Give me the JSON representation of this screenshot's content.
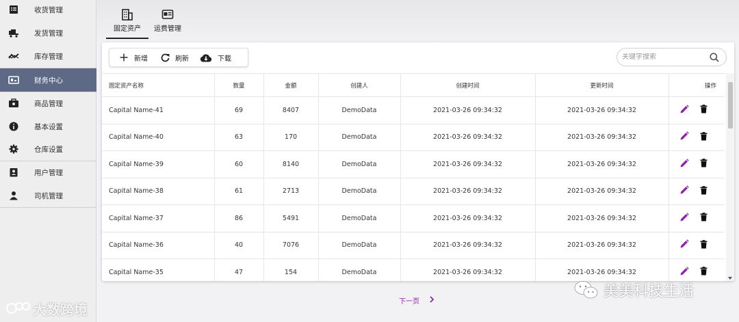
{
  "sidebar": {
    "items": [
      {
        "label": "收货管理",
        "icon": "receipt-list-icon",
        "active": false
      },
      {
        "label": "发货管理",
        "icon": "truck-icon",
        "active": false
      },
      {
        "label": "库存管理",
        "icon": "trend-icon",
        "active": false
      },
      {
        "label": "财务中心",
        "icon": "finance-icon",
        "active": true
      },
      {
        "label": "商品管理",
        "icon": "product-box-icon",
        "active": false
      },
      {
        "label": "基本设置",
        "icon": "info-icon",
        "active": false
      },
      {
        "label": "仓库设置",
        "icon": "gear-icon",
        "active": false
      },
      {
        "label": "用户管理",
        "icon": "user-badge-icon",
        "active": false
      },
      {
        "label": "司机管理",
        "icon": "driver-person-icon",
        "active": false
      }
    ]
  },
  "tabs": [
    {
      "label": "固定资产",
      "icon": "building-icon",
      "active": true
    },
    {
      "label": "运费管理",
      "icon": "freight-card-icon",
      "active": false
    }
  ],
  "toolbar": {
    "add_label": "新增",
    "refresh_label": "刷新",
    "download_label": "下载"
  },
  "search": {
    "placeholder": "关键字搜索",
    "icon": "search-icon"
  },
  "table": {
    "columns": [
      "固定资产名称",
      "数量",
      "金额",
      "创建人",
      "创建时间",
      "更新时间",
      "操作"
    ],
    "rows": [
      [
        "Capital Name-41",
        "69",
        "8407",
        "DemoData",
        "2021-03-26 09:34:32",
        "2021-03-26 09:34:32"
      ],
      [
        "Capital Name-40",
        "63",
        "170",
        "DemoData",
        "2021-03-26 09:34:32",
        "2021-03-26 09:34:32"
      ],
      [
        "Capital Name-39",
        "60",
        "8140",
        "DemoData",
        "2021-03-26 09:34:32",
        "2021-03-26 09:34:32"
      ],
      [
        "Capital Name-38",
        "61",
        "2713",
        "DemoData",
        "2021-03-26 09:34:32",
        "2021-03-26 09:34:32"
      ],
      [
        "Capital Name-37",
        "86",
        "5491",
        "DemoData",
        "2021-03-26 09:34:32",
        "2021-03-26 09:34:32"
      ],
      [
        "Capital Name-36",
        "40",
        "7076",
        "DemoData",
        "2021-03-26 09:34:32",
        "2021-03-26 09:34:32"
      ],
      [
        "Capital Name-35",
        "47",
        "154",
        "DemoData",
        "2021-03-26 09:34:32",
        "2021-03-26 09:34:32"
      ]
    ],
    "edit_icon": "edit-pencil-icon",
    "delete_icon": "trash-icon"
  },
  "pagination": {
    "next_label": "下一页",
    "icon": "chevron-right-icon"
  },
  "watermarks": {
    "left": "大数跨境",
    "right": "美美科技生活"
  },
  "colors": {
    "accent": "#8e24aa",
    "sidebar_active_bg": "#5e6a85",
    "icon_dark": "#222222"
  }
}
